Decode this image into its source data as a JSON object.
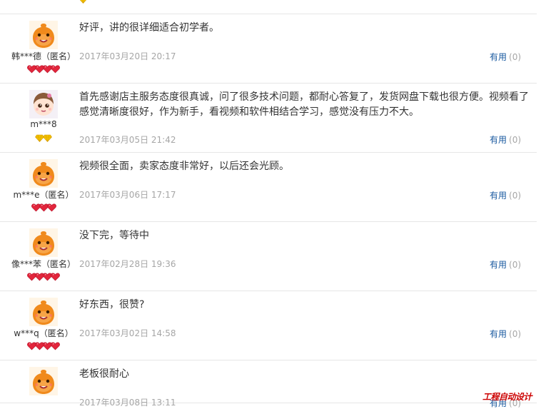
{
  "reviews": [
    {
      "username": "韩***德（匿名）",
      "avatar": "orange-mascot",
      "badge_type": "red-heart",
      "badge_count": 4,
      "content": "好评，讲的很详细适合初学者。",
      "date": "2017年03月20日 20:17",
      "helpful_label": "有用",
      "helpful_count": "(0)"
    },
    {
      "username": "m***8",
      "avatar": "girl-face",
      "badge_type": "yellow-diamond",
      "badge_count": 2,
      "content": "首先感谢店主服务态度很真诚，问了很多技术问题，都耐心答复了，发货网盘下载也很方便。视频看了感觉清晰度很好，作为新手，看视频和软件相结合学习，感觉没有压力不大。",
      "date": "2017年03月05日 21:42",
      "helpful_label": "有用",
      "helpful_count": "(0)"
    },
    {
      "username": "m***e（匿名）",
      "avatar": "orange-mascot",
      "badge_type": "red-heart",
      "badge_count": 3,
      "content": "视频很全面，卖家态度非常好，以后还会光顾。",
      "date": "2017年03月06日 17:17",
      "helpful_label": "有用",
      "helpful_count": "(0)"
    },
    {
      "username": "像***苯（匿名）",
      "avatar": "orange-mascot",
      "badge_type": "red-heart",
      "badge_count": 4,
      "content": "没下完，等待中",
      "date": "2017年02月28日 19:36",
      "helpful_label": "有用",
      "helpful_count": "(0)"
    },
    {
      "username": "w***q（匿名）",
      "avatar": "orange-mascot",
      "badge_type": "red-heart",
      "badge_count": 4,
      "content": "好东西，很赞?",
      "date": "2017年03月02日 14:58",
      "helpful_label": "有用",
      "helpful_count": "(0)"
    },
    {
      "username": "",
      "avatar": "orange-mascot",
      "badge_type": "red-heart",
      "badge_count": 0,
      "content": "老板很耐心",
      "date": "2017年03月08日 13:11",
      "helpful_label": "有用",
      "helpful_count": "(0)"
    }
  ],
  "top_partial_badge": "yellow-diamond",
  "watermark": "工程自动设计",
  "colors": {
    "link": "#1a5aa0",
    "muted": "#a6a6a6",
    "divider": "#e6e6e6",
    "mascot": "#f08a1c",
    "heart": "#e2263c",
    "diamond": "#f5c400"
  }
}
